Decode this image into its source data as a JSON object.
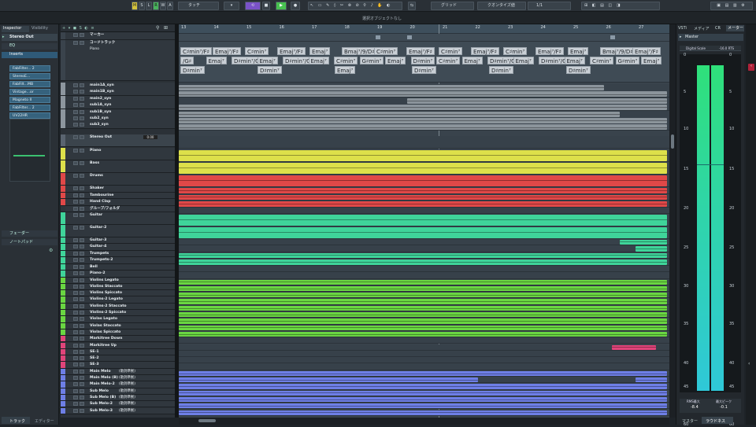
{
  "toolbar": {
    "btn_m": "M",
    "btn_s": "S",
    "btn_l": "L",
    "btn_r": "R",
    "btn_w": "W",
    "btn_a": "A",
    "automation_mode": "タッチ",
    "snap_type": "グリッド",
    "quantize": "クオンタイズ値",
    "quantize_value": "1/1"
  },
  "statusbar": {
    "message": "選択オブジェクトなし"
  },
  "inspector": {
    "tab_inspector": "Inspector",
    "tab_visibility": "Visibility",
    "selected_track": "Stereo Out",
    "section_eq": "EQ",
    "section_inserts": "Inserts",
    "inserts": [
      "FabFilter... 2",
      "StereoE...",
      "FabFilt...MB",
      "Vintage...or",
      "Magneto II",
      "FabFilter... 2",
      "UV22HR"
    ],
    "section_fader": "フェーダー",
    "section_notepad": "ノートパッド",
    "bottom_tab_track": "トラック",
    "bottom_tab_editor": "エディター"
  },
  "tracklist": {
    "marker_label": "マーカー",
    "chord_label": "コードトラック",
    "chord_piano": "Piano",
    "stereo_out_label": "Stereo Out",
    "stereo_out_value": "0.00",
    "group_folder": "グループ/フォルダ",
    "tracks_top": [
      "main1A_syn",
      "main1B_syn",
      "main2_syn",
      "sub1A_syn",
      "sub1B_syn",
      "sub2_syn",
      "sub3_syn"
    ],
    "tracks_mid": [
      "Piano",
      "Bass",
      "Drums",
      "Shaker",
      "Tambourine",
      "Hand Clap"
    ],
    "tracks_guitar": [
      "Guitar",
      "Guitar-2",
      "Guitar-3",
      "Guitar-4",
      "Trumpets",
      "Trumpets-2",
      "Bell",
      "Piano-2"
    ],
    "tracks_strings": [
      "Violins Legato",
      "Violins Staccato",
      "Violins Spiccato",
      "Violins-2 Legato",
      "Violins-2 Staccato",
      "Violins-2 Spiccato",
      "Violas Legato",
      "Violas Staccato",
      "Violas Spiccato"
    ],
    "tracks_fx": [
      "Markitree Down",
      "Markitree Up",
      "SE-1",
      "SE-2",
      "SE-3"
    ],
    "tracks_vocal": [
      "Main Melo",
      "Main Melo (B)",
      "Main Melo-2",
      "Sub Melo",
      "Sub Melo (B)",
      "Sub Melo-2",
      "Sub Melo-3"
    ],
    "vocal_tag": "(歌詞準拠)"
  },
  "ruler": [
    "13",
    "14",
    "15",
    "16",
    "17",
    "18",
    "19",
    "20",
    "21",
    "22",
    "23",
    "24",
    "25",
    "26",
    "27"
  ],
  "chords": {
    "row1": [
      "C♯min⁷/F♯",
      "Emaj⁷/F♯",
      "C♯min⁷",
      "Emaj⁷/F♯",
      "Emaj⁷",
      "Bmaj⁷/9/D♯",
      "C♯min⁷",
      "Emaj⁷/F♯",
      "C♯min⁷",
      "Emaj⁷/F♯",
      "C♯min⁷",
      "Emaj⁷/F♯",
      "Emaj⁷",
      "Bmaj⁷/9/D♯",
      "Emaj⁷/F♯"
    ],
    "row2": [
      "/G♯",
      "Emaj⁷",
      "D♯min⁷/G♯",
      "Emaj⁷",
      "D♯min⁷/G♯",
      "Emaj⁷",
      "C♯min⁷",
      "G♯min⁷",
      "Emaj⁷",
      "D♯min⁷",
      "C♯min⁷",
      "Emaj⁷",
      "D♯min⁷/G♯",
      "Emaj⁷",
      "D♯min⁷/G♯",
      "Emaj⁷",
      "C♯min⁷",
      "G♯min⁷",
      "Emaj⁷"
    ],
    "row3": [
      "D♯min⁷",
      "D♯min⁷",
      "Emaj⁷",
      "D♯min⁷",
      "D♯min⁷",
      "D♯min⁷"
    ]
  },
  "right": {
    "tab_vsti": "VSTi",
    "tab_media": "メディア",
    "tab_cr": "CR",
    "tab_meter": "メーター",
    "master": "Master",
    "scale_name": "Digital Scale",
    "scale_value": "-16.0 RTS",
    "meter_left": 0.98,
    "meter_right": 0.98,
    "scale": [
      "0",
      "5",
      "10",
      "15",
      "20",
      "25",
      "30",
      "35",
      "40",
      "45",
      "50",
      "60"
    ],
    "rms_label": "RMS最大",
    "rms_value": "-8.4",
    "peak_label": "最大ピーク",
    "peak_value": "-0.1",
    "bottom_tab_master": "マスター",
    "bottom_tab_loudness": "ラウドネス"
  },
  "colors": {
    "yellow": "#dde04a",
    "red": "#e04848",
    "teal": "#3fd49a",
    "green": "#6ad642",
    "pink": "#e0447a",
    "blue": "#6e7fe6",
    "grey": "#8d969e",
    "meter": "#2fd0d0"
  }
}
